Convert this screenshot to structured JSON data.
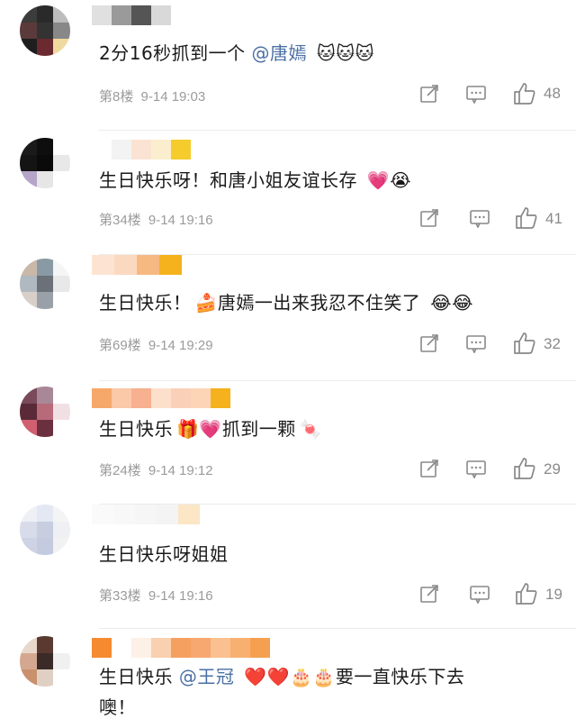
{
  "comments": [
    {
      "text": "2分16秒抓到一个",
      "mention": "@唐嫣",
      "emoji": "🐱🐱🐱",
      "floor": "第8楼",
      "time": "9-14 19:03",
      "likes": "48"
    },
    {
      "text": "生日快乐呀！和唐小姐友谊长存",
      "emoji": "💗😭",
      "floor": "第34楼",
      "time": "9-14 19:16",
      "likes": "41"
    },
    {
      "text": "生日快乐！",
      "emoji_mid": "🍰",
      "text2": "唐嫣一出来我忍不住笑了",
      "emoji": "😂😂",
      "floor": "第69楼",
      "time": "9-14 19:29",
      "likes": "32"
    },
    {
      "text": "生日快乐",
      "emoji_mid": "🎁💗",
      "text2": "抓到一颗",
      "emoji": "🍬",
      "floor": "第24楼",
      "time": "9-14 19:12",
      "likes": "29"
    },
    {
      "text": "生日快乐呀姐姐",
      "floor": "第33楼",
      "time": "9-14 19:16",
      "likes": "19"
    },
    {
      "text": "生日快乐",
      "mention": "@王冠",
      "emoji": "❤️❤️🎂🎂",
      "text2": "要一直快乐下去",
      "line2": "噢！"
    }
  ]
}
